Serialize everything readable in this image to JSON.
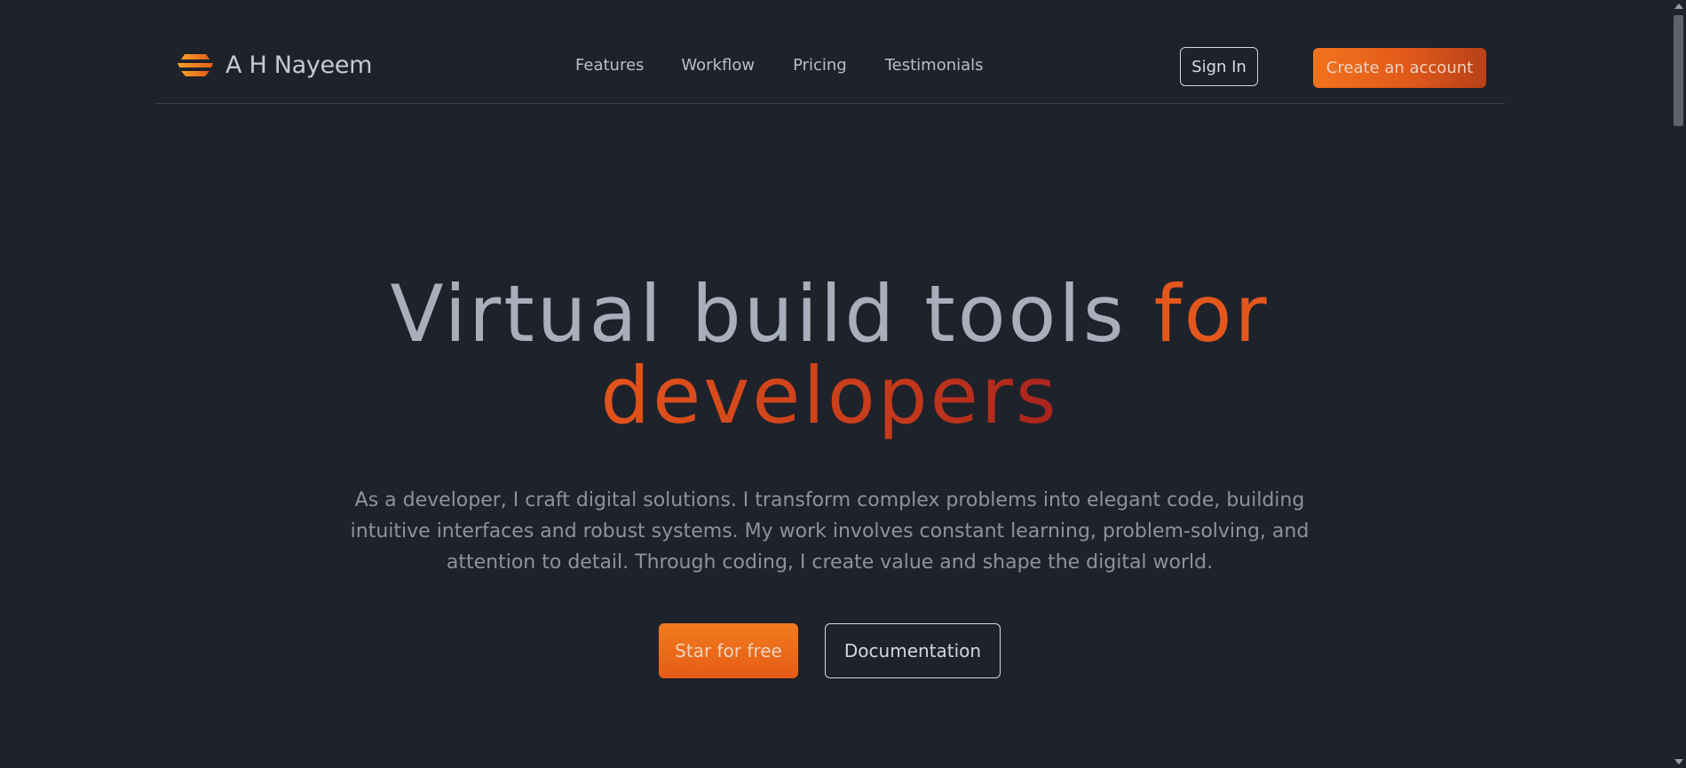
{
  "brand": {
    "name": "A H Nayeem",
    "logo_icon": "stacked-layers-logo-icon",
    "logo_colors": [
      "#f58a1f",
      "#e85d17"
    ]
  },
  "nav": {
    "links": [
      "Features",
      "Workflow",
      "Pricing",
      "Testimonials"
    ]
  },
  "header_actions": {
    "sign_in": "Sign In",
    "create_account": "Create an account"
  },
  "hero": {
    "title_part1": "Virtual build tools ",
    "title_accent1": "for",
    "title_accent2": "developers",
    "description": "As a developer, I craft digital solutions. I transform complex problems into elegant code, building intuitive interfaces and robust systems. My work involves constant learning, problem-solving, and attention to detail. Through coding, I create value and shape the digital world.",
    "primary_button": "Star for free",
    "secondary_button": "Documentation"
  },
  "colors": {
    "background": "#1e222a",
    "accent": "#e3571c",
    "accent_dark": "#a8241d",
    "text_muted": "#8d929c"
  }
}
